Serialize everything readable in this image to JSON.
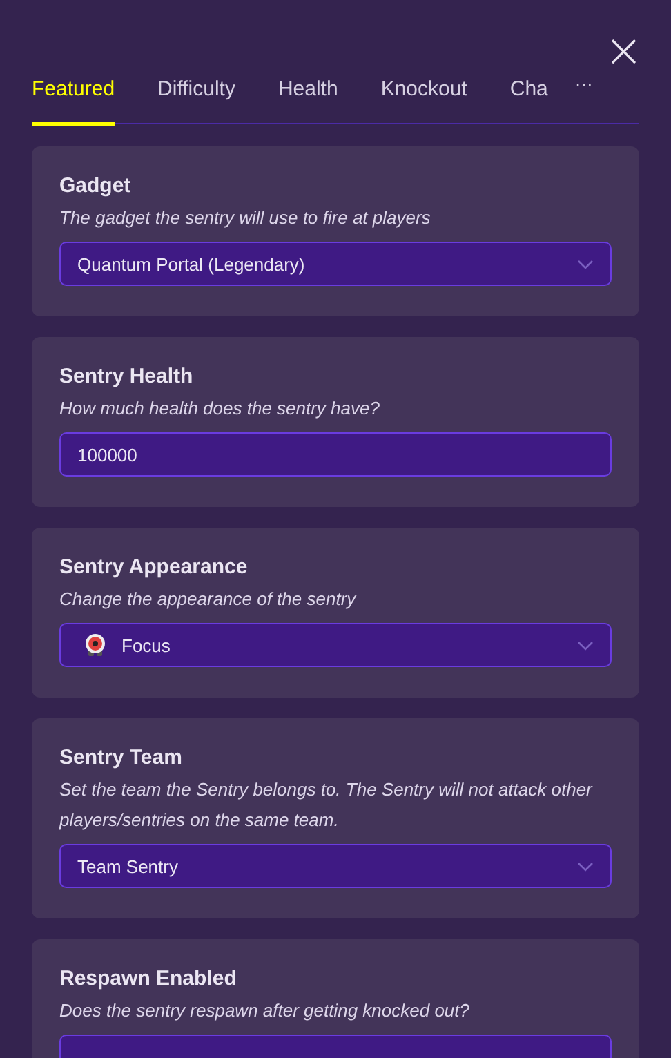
{
  "close": "×",
  "tabs": [
    {
      "label": "Featured",
      "selected": true
    },
    {
      "label": "Difficulty",
      "selected": false
    },
    {
      "label": "Health",
      "selected": false
    },
    {
      "label": "Knockout",
      "selected": false
    },
    {
      "label": "Cha",
      "selected": false
    }
  ],
  "more": "···",
  "settings": [
    {
      "title": "Gadget",
      "description": "The gadget the sentry will use to fire at players",
      "control": {
        "kind": "select",
        "value": "Quantum Portal (Legendary)"
      }
    },
    {
      "title": "Sentry Health",
      "description": "How much health does the sentry have?",
      "control": {
        "kind": "input",
        "value": "100000"
      }
    },
    {
      "title": "Sentry Appearance",
      "description": "Change the appearance of the sentry",
      "control": {
        "kind": "select",
        "value": "Focus",
        "avatar": true
      }
    },
    {
      "title": "Sentry Team",
      "description": "Set the team the Sentry belongs to. The Sentry will not attack other players/sentries on the same team.",
      "control": {
        "kind": "select",
        "value": "Team Sentry"
      }
    },
    {
      "title": "Respawn Enabled",
      "description": "Does the sentry respawn after getting knocked out?",
      "control": {
        "kind": "blank"
      }
    }
  ]
}
